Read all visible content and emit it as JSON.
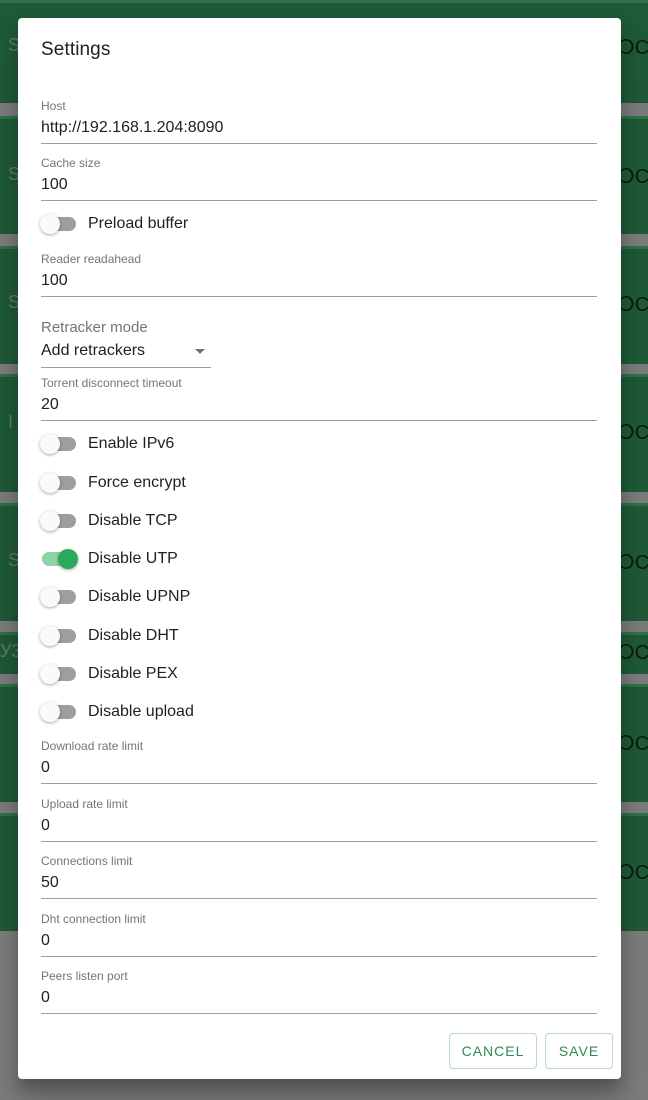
{
  "background": {
    "left_stubs": [
      "S",
      "S",
      "S",
      "I",
      "",
      "S",
      "УЗ",
      "",
      ""
    ],
    "right_stub": "ⵔC"
  },
  "dialog": {
    "title": "Settings",
    "fields": {
      "host": {
        "label": "Host",
        "value": "http://192.168.1.204:8090"
      },
      "cache_size": {
        "label": "Cache size",
        "value": "100"
      },
      "reader_readahead": {
        "label": "Reader readahead",
        "value": "100"
      },
      "torrent_disconnect_timeout": {
        "label": "Torrent disconnect timeout",
        "value": "20"
      },
      "download_rate_limit": {
        "label": "Download rate limit",
        "value": "0"
      },
      "upload_rate_limit": {
        "label": "Upload rate limit",
        "value": "0"
      },
      "connections_limit": {
        "label": "Connections limit",
        "value": "50"
      },
      "dht_connection_limit": {
        "label": "Dht connection limit",
        "value": "0"
      },
      "peers_listen_port": {
        "label": "Peers listen port",
        "value": "0"
      }
    },
    "retracker": {
      "label": "Retracker mode",
      "value": "Add retrackers"
    },
    "switches": {
      "preload_buffer": {
        "label": "Preload buffer",
        "checked": false
      },
      "enable_ipv6": {
        "label": "Enable IPv6",
        "checked": false
      },
      "force_encrypt": {
        "label": "Force encrypt",
        "checked": false
      },
      "disable_tcp": {
        "label": "Disable TCP",
        "checked": false
      },
      "disable_utp": {
        "label": "Disable UTP",
        "checked": true
      },
      "disable_upnp": {
        "label": "Disable UPNP",
        "checked": false
      },
      "disable_dht": {
        "label": "Disable DHT",
        "checked": false
      },
      "disable_pex": {
        "label": "Disable PEX",
        "checked": false
      },
      "disable_upload": {
        "label": "Disable upload",
        "checked": false
      }
    },
    "actions": {
      "cancel": "CANCEL",
      "save": "SAVE"
    }
  },
  "colors": {
    "accent": "#2aaa5a",
    "accent_track": "#8fd3a8",
    "button_text": "#2e8b57",
    "backdrop_card": "#1f5a36"
  }
}
